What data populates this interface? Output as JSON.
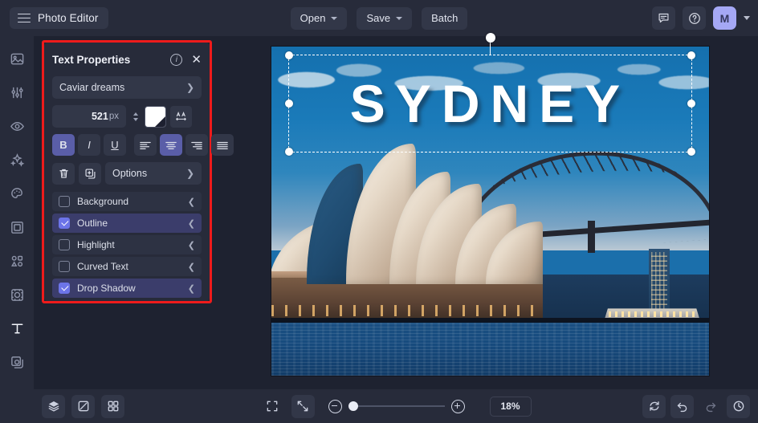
{
  "app": {
    "title": "Photo Editor",
    "menu_icon": "hamburger-icon"
  },
  "toolbar": {
    "open_label": "Open",
    "save_label": "Save",
    "batch_label": "Batch",
    "feedback_icon": "chat-icon",
    "help_icon": "question-circle-icon",
    "avatar_initial": "M"
  },
  "sidebar": {
    "items": [
      {
        "name": "image",
        "icon": "image-icon",
        "active": false
      },
      {
        "name": "adjust",
        "icon": "sliders-icon",
        "active": false
      },
      {
        "name": "retouch",
        "icon": "eye-icon",
        "active": false
      },
      {
        "name": "effects",
        "icon": "sparkles-icon",
        "active": false
      },
      {
        "name": "paint",
        "icon": "palette-icon",
        "active": false
      },
      {
        "name": "frames",
        "icon": "frame-icon",
        "active": false
      },
      {
        "name": "shapes",
        "icon": "shapes-icon",
        "active": false
      },
      {
        "name": "focus",
        "icon": "focus-icon",
        "active": false
      },
      {
        "name": "text",
        "icon": "text-t-icon",
        "active": true
      },
      {
        "name": "layers",
        "icon": "layers-overlay-icon",
        "active": false
      }
    ]
  },
  "panel": {
    "title": "Text Properties",
    "info_icon": "info-icon",
    "close_icon": "close-icon",
    "font": {
      "value": "Caviar dreams",
      "chevron": "chevron-right-icon"
    },
    "size": {
      "value": "521",
      "unit": "px",
      "stepper_icon": "stepper-icon"
    },
    "color": {
      "swatch_hex": "#ffffff",
      "swatch_icon": "color-swatch-icon"
    },
    "letter_spacing_icon": "letter-spacing-icon",
    "format": {
      "bold_label": "B",
      "bold_active": true,
      "italic_label": "I",
      "italic_active": false,
      "underline_label": "U",
      "underline_active": false,
      "align_left_icon": "align-left-icon",
      "align_center_icon": "align-center-icon",
      "align_center_active": true,
      "align_right_icon": "align-right-icon",
      "align_justify_icon": "align-justify-icon"
    },
    "actions": {
      "delete_icon": "trash-icon",
      "duplicate_icon": "duplicate-icon",
      "options_label": "Options",
      "options_chevron": "chevron-right-icon"
    },
    "toggles": [
      {
        "label": "Background",
        "checked": false,
        "chevron": "chevron-down-icon"
      },
      {
        "label": "Outline",
        "checked": true,
        "chevron": "chevron-down-icon"
      },
      {
        "label": "Highlight",
        "checked": false,
        "chevron": "chevron-down-icon"
      },
      {
        "label": "Curved Text",
        "checked": false,
        "chevron": "chevron-down-icon"
      },
      {
        "label": "Drop Shadow",
        "checked": true,
        "chevron": "chevron-down-icon"
      }
    ],
    "highlight_border_hex": "#ee1b1b",
    "accent_hex": "#6c74e8"
  },
  "canvas": {
    "text_layer_value": "SYDNEY",
    "selection_handles": "resize-handle",
    "rotate_handle": "rotate-handle",
    "image_subject": "sydney-opera-house-harbour-bridge"
  },
  "bottombar": {
    "layers_icon": "layers-icon",
    "transform_icon": "transform-icon",
    "grid_icon": "grid-icon",
    "fit_screen_icon": "fit-screen-icon",
    "actual_size_icon": "actual-size-icon",
    "zoom_out_icon": "zoom-out-icon",
    "zoom_in_icon": "zoom-in-icon",
    "zoom_value": "18%",
    "reset_icon": "reset-icon",
    "undo_icon": "undo-icon",
    "redo_icon": "redo-icon",
    "history_icon": "history-icon"
  }
}
